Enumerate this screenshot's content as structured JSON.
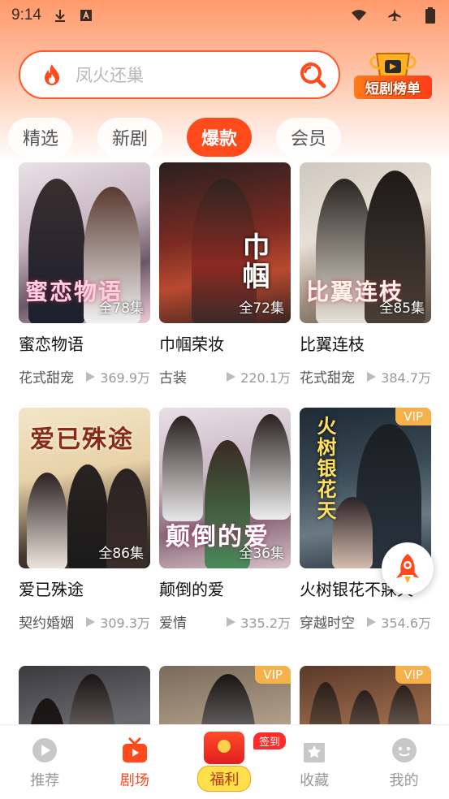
{
  "status_bar": {
    "time": "9:14"
  },
  "search": {
    "placeholder": "凤火还巢"
  },
  "rank_badge": {
    "label": "短剧榜单"
  },
  "tabs": [
    {
      "label": "精选",
      "active": false
    },
    {
      "label": "新剧",
      "active": false
    },
    {
      "label": "爆款",
      "active": true
    },
    {
      "label": "会员",
      "active": false
    }
  ],
  "dramas": [
    {
      "title": "蜜恋物语",
      "genre": "花式甜宠",
      "views": "369.9万",
      "episodes": "全78集",
      "vip": false,
      "poster_text": "蜜恋物语"
    },
    {
      "title": "巾帼荣妆",
      "genre": "古装",
      "views": "220.1万",
      "episodes": "全72集",
      "vip": false,
      "poster_text": "巾帼"
    },
    {
      "title": "比翼连枝",
      "genre": "花式甜宠",
      "views": "384.7万",
      "episodes": "全85集",
      "vip": false,
      "poster_text": "比翼连枝"
    },
    {
      "title": "爱已殊途",
      "genre": "契约婚姻",
      "views": "309.3万",
      "episodes": "全86集",
      "vip": false,
      "poster_text": "爱已殊途"
    },
    {
      "title": "颠倒的爱",
      "genre": "爱情",
      "views": "335.2万",
      "episodes": "全36集",
      "vip": false,
      "poster_text": "颠倒的爱"
    },
    {
      "title": "火树银花不寐天",
      "genre": "穿越时空",
      "views": "354.6万",
      "episodes": "",
      "vip": true,
      "vip_label": "VIP",
      "poster_text": "火树银花天"
    },
    {
      "title": "",
      "genre": "",
      "views": "",
      "episodes": "",
      "vip": false,
      "poster_text": ""
    },
    {
      "title": "",
      "genre": "",
      "views": "",
      "episodes": "",
      "vip": true,
      "vip_label": "VIP",
      "poster_text": ""
    },
    {
      "title": "",
      "genre": "",
      "views": "",
      "episodes": "",
      "vip": true,
      "vip_label": "VIP",
      "poster_text": ""
    }
  ],
  "bottom_nav": {
    "items": [
      {
        "label": "推荐",
        "icon": "play-circle-icon",
        "active": false
      },
      {
        "label": "剧场",
        "icon": "tv-icon",
        "active": true
      },
      {
        "label": "福利",
        "icon": "red-envelope-icon",
        "active": false,
        "badge": "签到"
      },
      {
        "label": "收藏",
        "icon": "star-box-icon",
        "active": false
      },
      {
        "label": "我的",
        "icon": "smiley-icon",
        "active": false
      }
    ]
  },
  "colors": {
    "accent": "#ff4a1c",
    "vip": "#f5b14a"
  }
}
